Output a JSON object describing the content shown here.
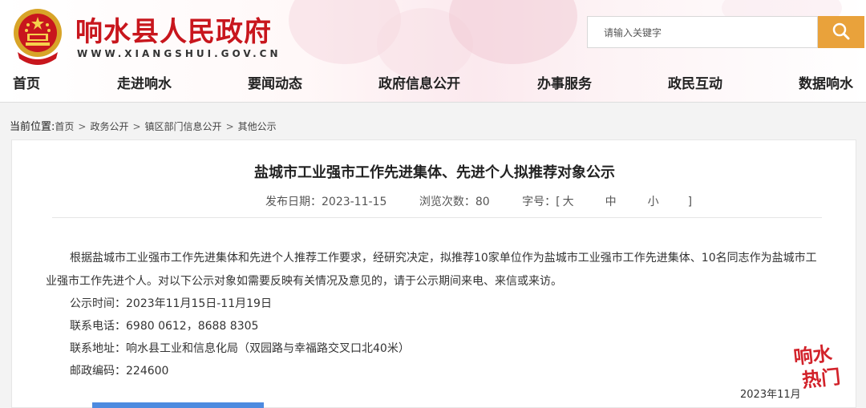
{
  "site": {
    "title": "响水县人民政府",
    "url": "WWW.XIANGSHUI.GOV.CN"
  },
  "search": {
    "placeholder": "请输入关键字",
    "icon": "search-icon"
  },
  "colors": {
    "brand_red": "#c8161d",
    "search_button": "#e9a23b",
    "accent_blue": "#4d8be0"
  },
  "nav": {
    "items": [
      "首页",
      "走进响水",
      "要闻动态",
      "政府信息公开",
      "办事服务",
      "政民互动",
      "数据响水"
    ]
  },
  "breadcrumb": {
    "lead": "当前位置:",
    "items": [
      "首页",
      "政务公开",
      "镇区部门信息公开",
      "其他公示"
    ],
    "separator": ">"
  },
  "article": {
    "title": "盐城市工业强市工作先进集体、先进个人拟推荐对象公示",
    "publish_date": "发布日期：2023-11-15",
    "views": "浏览次数：80",
    "font_size_label": "字号：[",
    "font_sizes": [
      "大",
      "中",
      "小"
    ],
    "font_size_close": "]",
    "para1_line1": "根据盐城市工业强市工作先进集体和先进个人推荐工作要求，经研究决定，拟推荐10家单位作为盐城市工业强市工作先进集体、10名同志作为盐城市工",
    "para1_line2": "业强市工作先进个人。对以下公示对象如需要反映有关情况及意见的，请于公示期间来电、来信或来访。",
    "period": "公示时间：2023年11月15日-11月19日",
    "phone": "联系电话：6980 0612，8688 8305",
    "address": "联系地址：响水县工业和信息化局（双园路与幸福路交叉口北40米）",
    "postcode": "邮政编码：224600",
    "sign_date": "2023年11月"
  },
  "watermark": {
    "line1": "响水",
    "line2": "热门"
  }
}
